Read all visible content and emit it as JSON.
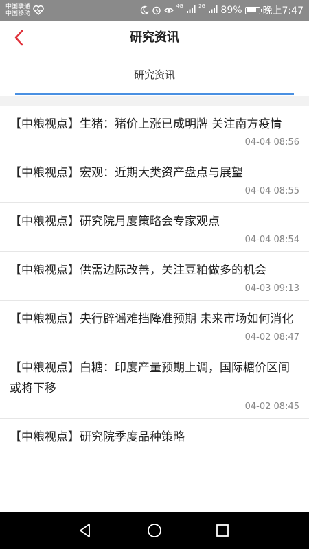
{
  "status_bar": {
    "carrier_1": "中国联通",
    "carrier_2": "中国移动",
    "network_1": "4G",
    "network_2": "2G",
    "battery": "89%",
    "battery_level": 0.89,
    "time": "晚上7:47"
  },
  "header": {
    "title": "研究资讯"
  },
  "tabs": [
    {
      "label": "研究资讯",
      "active": true
    }
  ],
  "news": [
    {
      "title": "【中粮视点】生猪：猪价上涨已成明牌 关注南方疫情",
      "time": "04-04 08:56"
    },
    {
      "title": "【中粮视点】宏观：近期大类资产盘点与展望",
      "time": "04-04 08:55"
    },
    {
      "title": "【中粮视点】研究院月度策略会专家观点",
      "time": "04-04 08:54"
    },
    {
      "title": "【中粮视点】供需边际改善，关注豆粕做多的机会",
      "time": "04-03 09:13"
    },
    {
      "title": "【中粮视点】央行辟谣难挡降准预期 未来市场如何消化",
      "time": "04-02 08:47"
    },
    {
      "title": "【中粮视点】白糖：印度产量预期上调，国际糖价区间或将下移",
      "time": "04-02 08:45"
    },
    {
      "title": "【中粮视点】研究院季度品种策略",
      "time": ""
    }
  ],
  "colors": {
    "accent_red": "#e0313a",
    "tab_underline": "#4a90e2",
    "status_bar_bg": "#8a8a8a"
  }
}
